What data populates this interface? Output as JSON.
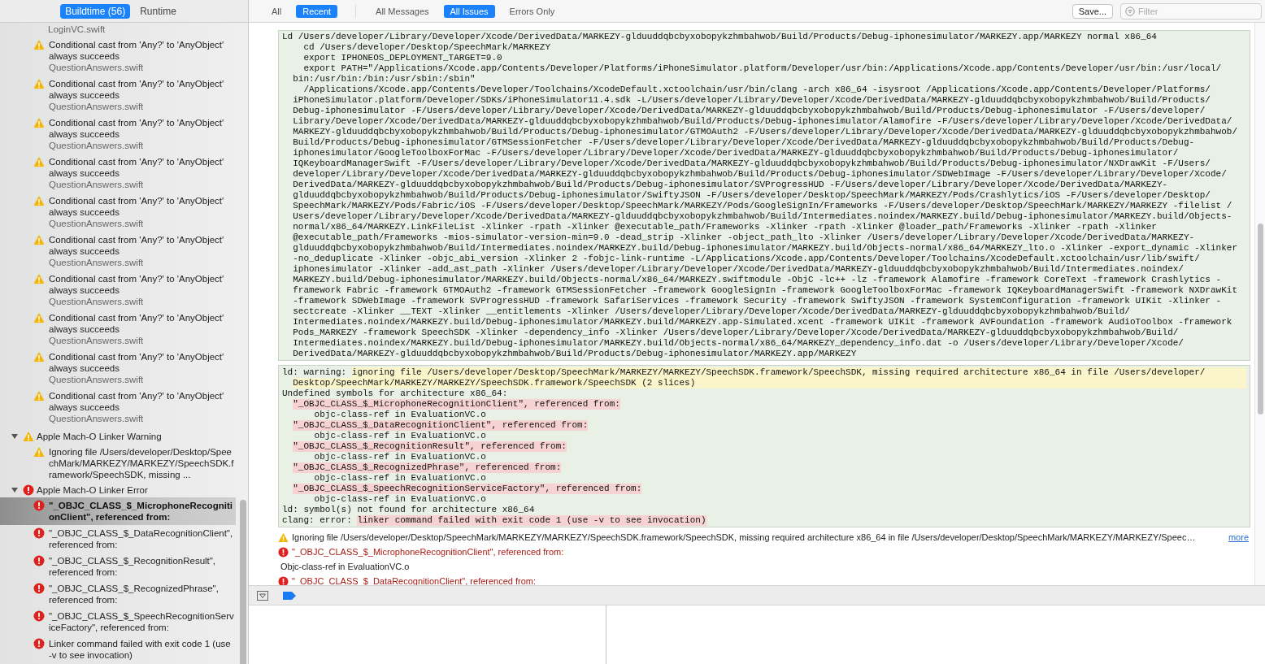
{
  "sidebar": {
    "tabs": [
      {
        "label": "Buildtime (56)",
        "selected": true
      },
      {
        "label": "Runtime",
        "selected": false
      }
    ],
    "cut_file": "LoginVC.swift",
    "issues": [
      {
        "kind": "warning",
        "text": "Conditional cast from 'Any?' to 'AnyObject' always succeeds",
        "file": "QuestionAnswers.swift",
        "selected": false
      },
      {
        "kind": "warning",
        "text": "Conditional cast from 'Any?' to 'AnyObject' always succeeds",
        "file": "QuestionAnswers.swift",
        "selected": false
      },
      {
        "kind": "warning",
        "text": "Conditional cast from 'Any?' to 'AnyObject' always succeeds",
        "file": "QuestionAnswers.swift",
        "selected": false
      },
      {
        "kind": "warning",
        "text": "Conditional cast from 'Any?' to 'AnyObject' always succeeds",
        "file": "QuestionAnswers.swift",
        "selected": false
      },
      {
        "kind": "warning",
        "text": "Conditional cast from 'Any?' to 'AnyObject' always succeeds",
        "file": "QuestionAnswers.swift",
        "selected": false
      },
      {
        "kind": "warning",
        "text": "Conditional cast from 'Any?' to 'AnyObject' always succeeds",
        "file": "QuestionAnswers.swift",
        "selected": false
      },
      {
        "kind": "warning",
        "text": "Conditional cast from 'Any?' to 'AnyObject' always succeeds",
        "file": "QuestionAnswers.swift",
        "selected": false
      },
      {
        "kind": "warning",
        "text": "Conditional cast from 'Any?' to 'AnyObject' always succeeds",
        "file": "QuestionAnswers.swift",
        "selected": false
      },
      {
        "kind": "warning",
        "text": "Conditional cast from 'Any?' to 'AnyObject' always succeeds",
        "file": "QuestionAnswers.swift",
        "selected": false
      },
      {
        "kind": "warning",
        "text": "Conditional cast from 'Any?' to 'AnyObject' always succeeds",
        "file": "QuestionAnswers.swift",
        "selected": false
      }
    ],
    "groups": [
      {
        "kind": "warning",
        "title": "Apple Mach-O Linker Warning",
        "expanded": true,
        "children": [
          {
            "kind": "warning",
            "text": "Ignoring file /Users/developer/Desktop/SpeechMark/MARKEZY/MARKEZY/SpeechSDK.framework/SpeechSDK, missing ...",
            "selected": false
          }
        ]
      },
      {
        "kind": "error",
        "title": "Apple Mach-O Linker Error",
        "expanded": true,
        "children": [
          {
            "kind": "error",
            "text": "\"_OBJC_CLASS_$_MicrophoneRecognitionClient\", referenced from:",
            "selected": true
          },
          {
            "kind": "error",
            "text": "\"_OBJC_CLASS_$_DataRecognitionClient\", referenced from:",
            "selected": false
          },
          {
            "kind": "error",
            "text": "\"_OBJC_CLASS_$_RecognitionResult\", referenced from:",
            "selected": false
          },
          {
            "kind": "error",
            "text": "\"_OBJC_CLASS_$_RecognizedPhrase\", referenced from:",
            "selected": false
          },
          {
            "kind": "error",
            "text": "\"_OBJC_CLASS_$_SpeechRecognitionServiceFactory\", referenced from:",
            "selected": false
          },
          {
            "kind": "error",
            "text": "Linker command failed with exit code 1 (use -v to see invocation)",
            "selected": false
          }
        ]
      }
    ]
  },
  "toolbar": {
    "scope_tabs": [
      {
        "label": "All",
        "selected": false
      },
      {
        "label": "Recent",
        "selected": true
      }
    ],
    "filter_tabs": [
      {
        "label": "All Messages",
        "selected": false
      },
      {
        "label": "All Issues",
        "selected": true
      },
      {
        "label": "Errors Only",
        "selected": false
      }
    ],
    "save_button": "Save...",
    "filter": {
      "placeholder": "Filter"
    }
  },
  "log": {
    "command_lines": [
      {
        "kind": "head",
        "text": "Ld /Users/developer/Library/Developer/Xcode/DerivedData/MARKEZY-glduuddqbcbyxobopykzhmbahwob/Build/Products/Debug-iphonesimulator/MARKEZY.app/MARKEZY normal x86_64"
      },
      {
        "kind": "step",
        "text": "cd /Users/developer/Desktop/SpeechMark/MARKEZY"
      },
      {
        "kind": "step",
        "text": "export IPHONEOS_DEPLOYMENT_TARGET=9.0"
      },
      {
        "kind": "step",
        "text": "export PATH=\"/Applications/Xcode.app/Contents/Developer/Platforms/iPhoneSimulator.platform/Developer/usr/bin:/Applications/Xcode.app/Contents/Developer/usr/bin:/usr/local/"
      },
      {
        "kind": "wrap",
        "text": "bin:/usr/bin:/bin:/usr/sbin:/sbin\""
      },
      {
        "kind": "step",
        "text": "/Applications/Xcode.app/Contents/Developer/Toolchains/XcodeDefault.xctoolchain/usr/bin/clang -arch x86_64 -isysroot /Applications/Xcode.app/Contents/Developer/Platforms/"
      },
      {
        "kind": "wrap",
        "text": "iPhoneSimulator.platform/Developer/SDKs/iPhoneSimulator11.4.sdk -L/Users/developer/Library/Developer/Xcode/DerivedData/MARKEZY-glduuddqbcbyxobopykzhmbahwob/Build/Products/"
      },
      {
        "kind": "wrap",
        "text": "Debug-iphonesimulator -F/Users/developer/Library/Developer/Xcode/DerivedData/MARKEZY-glduuddqbcbyxobopykzhmbahwob/Build/Products/Debug-iphonesimulator -F/Users/developer/"
      },
      {
        "kind": "wrap",
        "text": "Library/Developer/Xcode/DerivedData/MARKEZY-glduuddqbcbyxobopykzhmbahwob/Build/Products/Debug-iphonesimulator/Alamofire -F/Users/developer/Library/Developer/Xcode/DerivedData/"
      },
      {
        "kind": "wrap",
        "text": "MARKEZY-glduuddqbcbyxobopykzhmbahwob/Build/Products/Debug-iphonesimulator/GTMOAuth2 -F/Users/developer/Library/Developer/Xcode/DerivedData/MARKEZY-glduuddqbcbyxobopykzhmbahwob/"
      },
      {
        "kind": "wrap",
        "text": "Build/Products/Debug-iphonesimulator/GTMSessionFetcher -F/Users/developer/Library/Developer/Xcode/DerivedData/MARKEZY-glduuddqbcbyxobopykzhmbahwob/Build/Products/Debug-"
      },
      {
        "kind": "wrap",
        "text": "iphonesimulator/GoogleToolboxForMac -F/Users/developer/Library/Developer/Xcode/DerivedData/MARKEZY-glduuddqbcbyxobopykzhmbahwob/Build/Products/Debug-iphonesimulator/"
      },
      {
        "kind": "wrap",
        "text": "IQKeyboardManagerSwift -F/Users/developer/Library/Developer/Xcode/DerivedData/MARKEZY-glduuddqbcbyxobopykzhmbahwob/Build/Products/Debug-iphonesimulator/NXDrawKit -F/Users/"
      },
      {
        "kind": "wrap",
        "text": "developer/Library/Developer/Xcode/DerivedData/MARKEZY-glduuddqbcbyxobopykzhmbahwob/Build/Products/Debug-iphonesimulator/SDWebImage -F/Users/developer/Library/Developer/Xcode/"
      },
      {
        "kind": "wrap",
        "text": "DerivedData/MARKEZY-glduuddqbcbyxobopykzhmbahwob/Build/Products/Debug-iphonesimulator/SVProgressHUD -F/Users/developer/Library/Developer/Xcode/DerivedData/MARKEZY-"
      },
      {
        "kind": "wrap",
        "text": "glduuddqbcbyxobopykzhmbahwob/Build/Products/Debug-iphonesimulator/SwiftyJSON -F/Users/developer/Desktop/SpeechMark/MARKEZY/Pods/Crashlytics/iOS -F/Users/developer/Desktop/"
      },
      {
        "kind": "wrap",
        "text": "SpeechMark/MARKEZY/Pods/Fabric/iOS -F/Users/developer/Desktop/SpeechMark/MARKEZY/Pods/GoogleSignIn/Frameworks -F/Users/developer/Desktop/SpeechMark/MARKEZY/MARKEZY -filelist /"
      },
      {
        "kind": "wrap",
        "text": "Users/developer/Library/Developer/Xcode/DerivedData/MARKEZY-glduuddqbcbyxobopykzhmbahwob/Build/Intermediates.noindex/MARKEZY.build/Debug-iphonesimulator/MARKEZY.build/Objects-"
      },
      {
        "kind": "wrap",
        "text": "normal/x86_64/MARKEZY.LinkFileList -Xlinker -rpath -Xlinker @executable_path/Frameworks -Xlinker -rpath -Xlinker @loader_path/Frameworks -Xlinker -rpath -Xlinker"
      },
      {
        "kind": "wrap",
        "text": "@executable_path/Frameworks -mios-simulator-version-min=9.0 -dead_strip -Xlinker -object_path_lto -Xlinker /Users/developer/Library/Developer/Xcode/DerivedData/MARKEZY-"
      },
      {
        "kind": "wrap",
        "text": "glduuddqbcbyxobopykzhmbahwob/Build/Intermediates.noindex/MARKEZY.build/Debug-iphonesimulator/MARKEZY.build/Objects-normal/x86_64/MARKEZY_lto.o -Xlinker -export_dynamic -Xlinker"
      },
      {
        "kind": "wrap",
        "text": "-no_deduplicate -Xlinker -objc_abi_version -Xlinker 2 -fobjc-link-runtime -L/Applications/Xcode.app/Contents/Developer/Toolchains/XcodeDefault.xctoolchain/usr/lib/swift/"
      },
      {
        "kind": "wrap",
        "text": "iphonesimulator -Xlinker -add_ast_path -Xlinker /Users/developer/Library/Developer/Xcode/DerivedData/MARKEZY-glduuddqbcbyxobopykzhmbahwob/Build/Intermediates.noindex/"
      },
      {
        "kind": "wrap",
        "text": "MARKEZY.build/Debug-iphonesimulator/MARKEZY.build/Objects-normal/x86_64/MARKEZY.swiftmodule -ObjC -lc++ -lz -framework Alamofire -framework CoreText -framework Crashlytics -"
      },
      {
        "kind": "wrap",
        "text": "framework Fabric -framework GTMOAuth2 -framework GTMSessionFetcher -framework GoogleSignIn -framework GoogleToolboxForMac -framework IQKeyboardManagerSwift -framework NXDrawKit"
      },
      {
        "kind": "wrap",
        "text": "-framework SDWebImage -framework SVProgressHUD -framework SafariServices -framework Security -framework SwiftyJSON -framework SystemConfiguration -framework UIKit -Xlinker -"
      },
      {
        "kind": "wrap",
        "text": "sectcreate -Xlinker __TEXT -Xlinker __entitlements -Xlinker /Users/developer/Library/Developer/Xcode/DerivedData/MARKEZY-glduuddqbcbyxobopykzhmbahwob/Build/"
      },
      {
        "kind": "wrap",
        "text": "Intermediates.noindex/MARKEZY.build/Debug-iphonesimulator/MARKEZY.build/MARKEZY.app-Simulated.xcent -framework UIKit -framework AVFoundation -framework AudioToolbox -framework"
      },
      {
        "kind": "wrap",
        "text": "Pods_MARKEZY -framework SpeechSDK -Xlinker -dependency_info -Xlinker /Users/developer/Library/Developer/Xcode/DerivedData/MARKEZY-glduuddqbcbyxobopykzhmbahwob/Build/"
      },
      {
        "kind": "wrap",
        "text": "Intermediates.noindex/MARKEZY.build/Debug-iphonesimulator/MARKEZY.build/Objects-normal/x86_64/MARKEZY_dependency_info.dat -o /Users/developer/Library/Developer/Xcode/"
      },
      {
        "kind": "wrap",
        "text": "DerivedData/MARKEZY-glduuddqbcbyxobopykzhmbahwob/Build/Products/Debug-iphonesimulator/MARKEZY.app/MARKEZY"
      }
    ],
    "error_lines": [
      {
        "kind": "head",
        "parts": [
          {
            "kind": "plain",
            "text": "ld: warning:"
          },
          {
            "kind": "warning",
            "text": "ignoring file /Users/developer/Desktop/SpeechMark/MARKEZY/MARKEZY/SpeechSDK.framework/SpeechSDK, missing required architecture x86_64 in file /Users/developer/"
          }
        ]
      },
      {
        "kind": "wrap",
        "parts": [
          {
            "kind": "warning",
            "text": "Desktop/SpeechMark/MARKEZY/MARKEZY/SpeechSDK.framework/SpeechSDK (2 slices)"
          }
        ]
      },
      {
        "kind": "head",
        "parts": [
          {
            "kind": "plain",
            "text": "Undefined symbols for architecture x86_64:"
          }
        ]
      },
      {
        "kind": "wrap",
        "parts": [
          {
            "kind": "error",
            "text": "\"_OBJC_CLASS_$_MicrophoneRecognitionClient\", referenced from:"
          }
        ]
      },
      {
        "kind": "ref",
        "parts": [
          {
            "kind": "plain",
            "text": "objc-class-ref in EvaluationVC.o"
          }
        ]
      },
      {
        "kind": "wrap",
        "parts": [
          {
            "kind": "error",
            "text": "\"_OBJC_CLASS_$_DataRecognitionClient\", referenced from:"
          }
        ]
      },
      {
        "kind": "ref",
        "parts": [
          {
            "kind": "plain",
            "text": "objc-class-ref in EvaluationVC.o"
          }
        ]
      },
      {
        "kind": "wrap",
        "parts": [
          {
            "kind": "error",
            "text": "\"_OBJC_CLASS_$_RecognitionResult\", referenced from:"
          }
        ]
      },
      {
        "kind": "ref",
        "parts": [
          {
            "kind": "plain",
            "text": "objc-class-ref in EvaluationVC.o"
          }
        ]
      },
      {
        "kind": "wrap",
        "parts": [
          {
            "kind": "error",
            "text": "\"_OBJC_CLASS_$_RecognizedPhrase\", referenced from:"
          }
        ]
      },
      {
        "kind": "ref",
        "parts": [
          {
            "kind": "plain",
            "text": "objc-class-ref in EvaluationVC.o"
          }
        ]
      },
      {
        "kind": "wrap",
        "parts": [
          {
            "kind": "error",
            "text": "\"_OBJC_CLASS_$_SpeechRecognitionServiceFactory\", referenced from:"
          }
        ]
      },
      {
        "kind": "ref",
        "parts": [
          {
            "kind": "plain",
            "text": "objc-class-ref in EvaluationVC.o"
          }
        ]
      },
      {
        "kind": "head",
        "parts": [
          {
            "kind": "plain",
            "text": "ld: symbol(s) not found for architecture x86_64"
          }
        ]
      },
      {
        "kind": "head",
        "parts": [
          {
            "kind": "plain",
            "text": "clang: error:"
          },
          {
            "kind": "error",
            "text": "linker command failed with exit code 1 (use -v to see invocation)"
          }
        ]
      }
    ],
    "issues": [
      {
        "kind": "warning",
        "text": "Ignoring file /Users/developer/Desktop/SpeechMark/MARKEZY/MARKEZY/SpeechSDK.framework/SpeechSDK, missing required architecture x86_64 in file /Users/developer/Desktop/SpeechMark/MARKEZY/MARKEZY/Speec…",
        "link": "more"
      },
      {
        "kind": "error",
        "text": "\"_OBJC_CLASS_$_MicrophoneRecognitionClient\", referenced from:"
      },
      {
        "kind": "detail",
        "text": "Objc-class-ref in EvaluationVC.o"
      },
      {
        "kind": "error",
        "text": "\"_OBJC_CLASS_$_DataRecognitionClient\", referenced from:"
      }
    ]
  }
}
